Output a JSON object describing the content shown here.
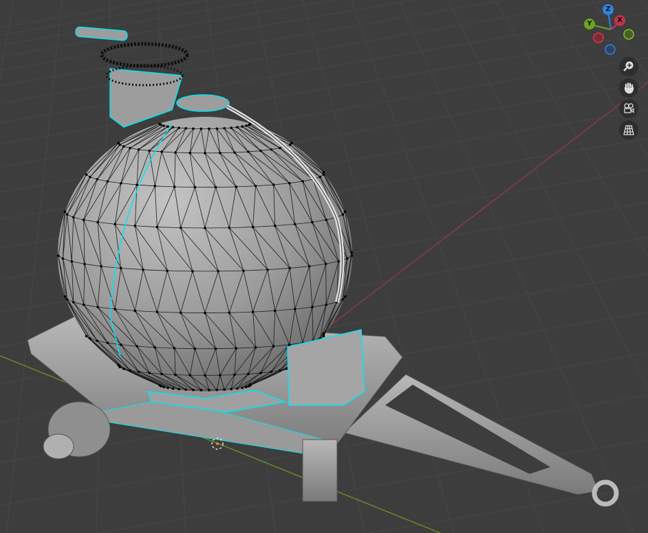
{
  "viewport": {
    "background": "#3d3d3d",
    "grid_color": "#474747",
    "x_axis_color": "#8a3a44",
    "y_axis_color": "#6a8a2a",
    "selection_color": "#00e5f5"
  },
  "gizmo": {
    "axes": [
      {
        "label": "Z",
        "color": "#2f84e3"
      },
      {
        "label": "Y",
        "color": "#6da51e"
      },
      {
        "label": "X",
        "color": "#d0374f"
      }
    ]
  },
  "nav_buttons": [
    {
      "name": "zoom-view-button",
      "icon": "magnifier-plus-icon"
    },
    {
      "name": "pan-view-button",
      "icon": "hand-icon"
    },
    {
      "name": "camera-view-button",
      "icon": "camera-icon"
    },
    {
      "name": "ortho-toggle-button",
      "icon": "grid-icon"
    }
  ]
}
